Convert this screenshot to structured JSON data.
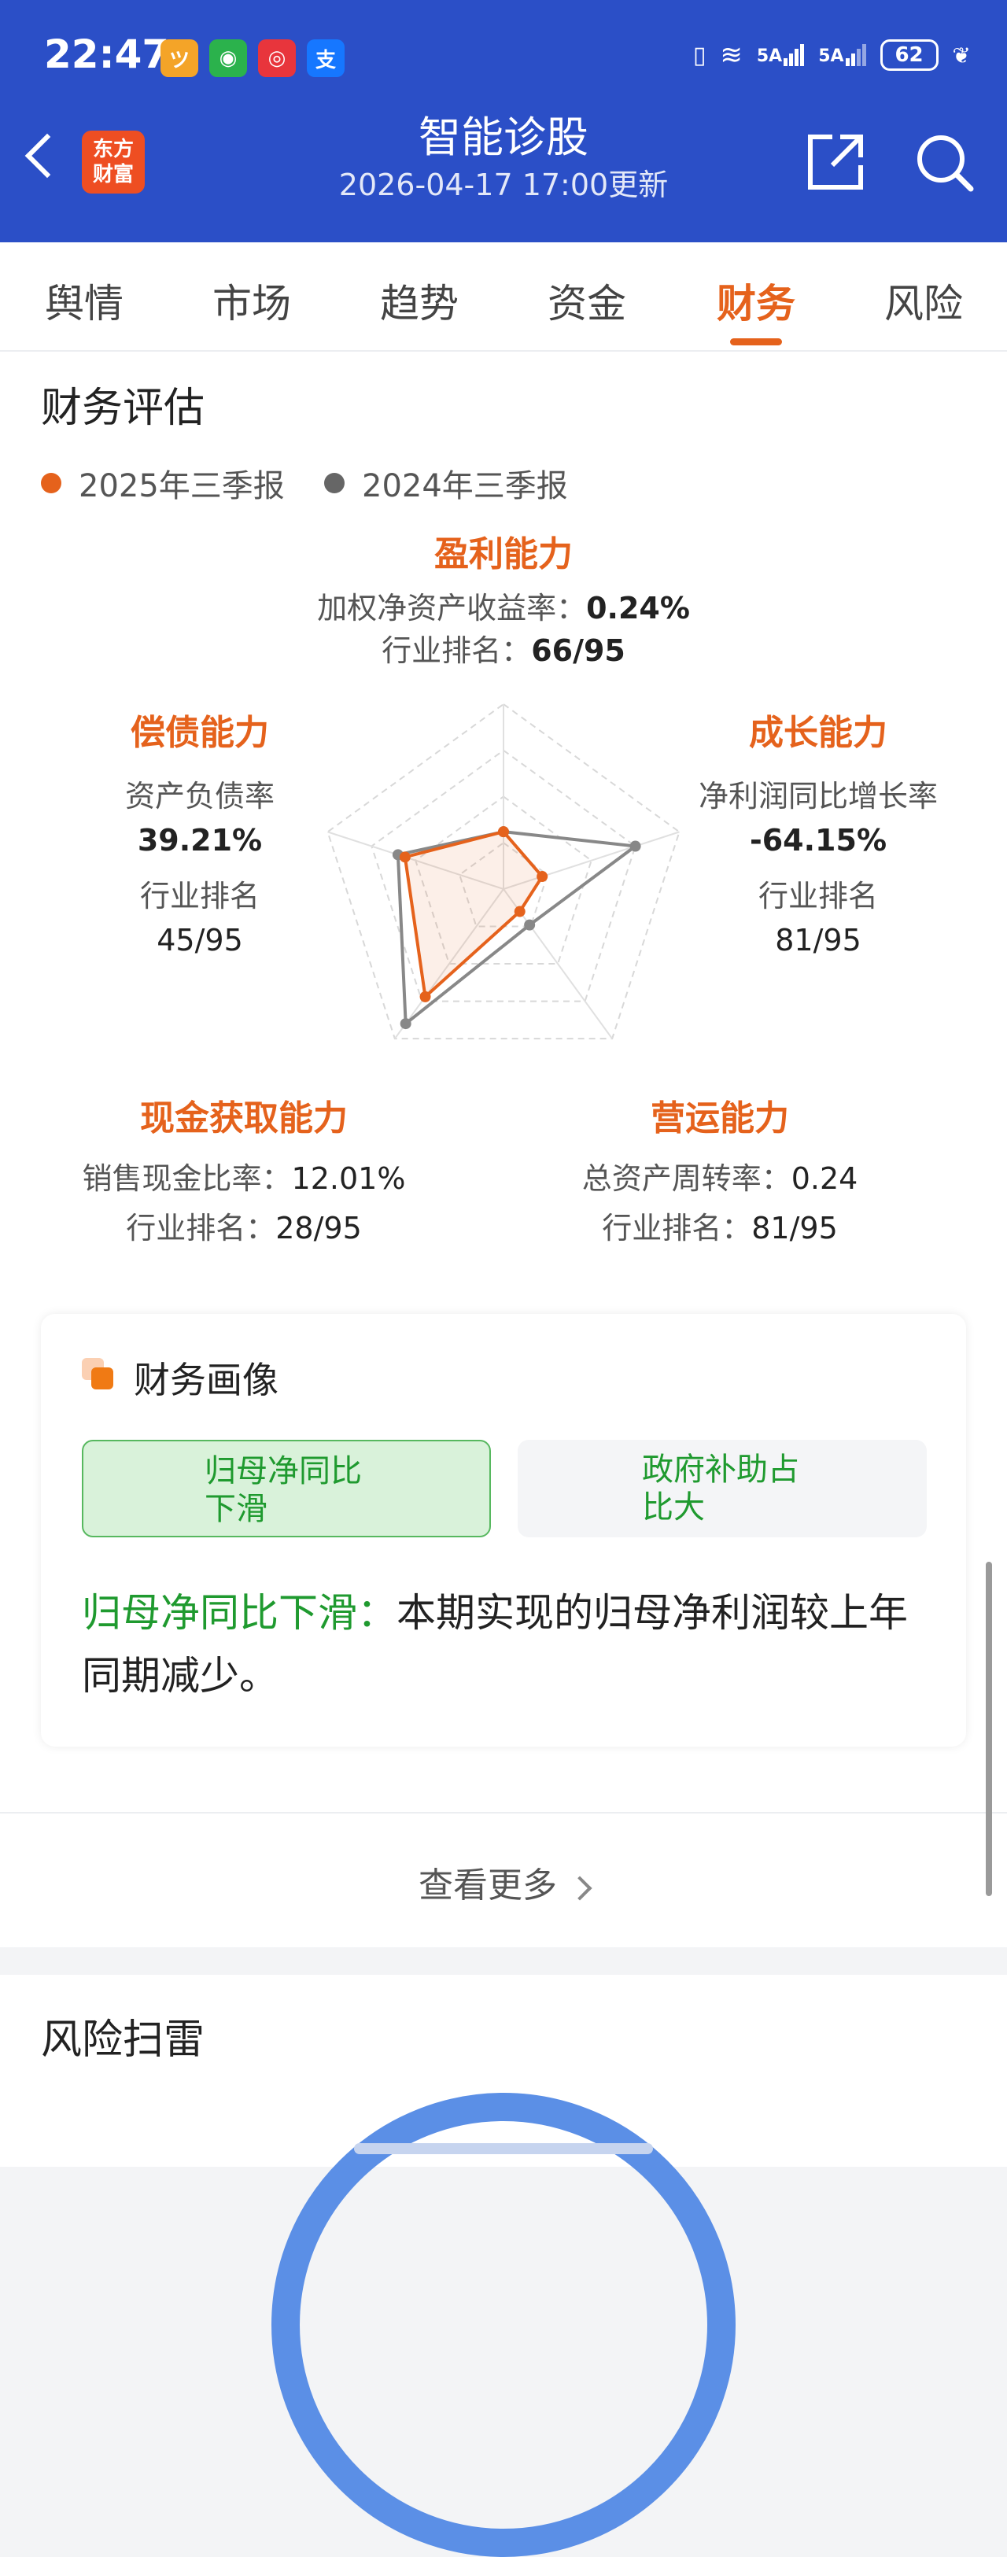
{
  "status_bar": {
    "time": "22:47",
    "net1": "5A",
    "net2": "5A",
    "battery": "62",
    "apps": [
      {
        "name": "app-icon-yellow",
        "color": "#f4a428",
        "glyph": "ツ"
      },
      {
        "name": "app-icon-green",
        "color": "#2bb24c",
        "glyph": "◉"
      },
      {
        "name": "app-icon-red",
        "color": "#e8353c",
        "glyph": "◎"
      },
      {
        "name": "alipay-icon",
        "color": "#1677ff",
        "glyph": "支"
      }
    ]
  },
  "header": {
    "brand_line1": "东方",
    "brand_line2": "财富",
    "title": "智能诊股",
    "subtitle": "2026-04-17 17:00更新",
    "bg_color": "#2b4fc7"
  },
  "tabs": [
    "舆情",
    "市场",
    "趋势",
    "资金",
    "财务",
    "风险"
  ],
  "active_tab_color": "#e5621c",
  "financial_eval": {
    "title": "财务评估",
    "legend": [
      {
        "label": "2025年三季报",
        "color": "#e5621c"
      },
      {
        "label": "2024年三季报",
        "color": "#666666"
      }
    ],
    "profit": {
      "title": "盈利能力",
      "metric_label": "加权净资产收益率：",
      "metric_value": "0.24%",
      "rank_label": "行业排名：",
      "rank_value": "66/95"
    },
    "debt": {
      "title": "偿债能力",
      "metric_label": "资产负债率",
      "metric_value": "39.21%",
      "rank_label": "行业排名",
      "rank_value": "45/95"
    },
    "growth": {
      "title": "成长能力",
      "metric_label": "净利润同比增长率",
      "metric_value": "-64.15%",
      "rank_label": "行业排名",
      "rank_value": "81/95"
    },
    "cash": {
      "title": "现金获取能力",
      "metric_label": "销售现金比率：",
      "metric_value": "12.01%",
      "rank_label": "行业排名：",
      "rank_value": "28/95"
    },
    "operation": {
      "title": "营运能力",
      "metric_label": "总资产周转率：",
      "metric_value": "0.24",
      "rank_label": "行业排名：",
      "rank_value": "81/95"
    }
  },
  "chart_data": {
    "type": "radar",
    "axes": [
      "盈利能力",
      "成长能力",
      "营运能力",
      "现金获取能力",
      "偿债能力"
    ],
    "range": [
      0,
      1
    ],
    "series": [
      {
        "name": "2025年三季报",
        "color": "#e5621c",
        "values": [
          0.31,
          0.22,
          0.15,
          0.72,
          0.56
        ]
      },
      {
        "name": "2024年三季报",
        "color": "#888888",
        "values": [
          0.31,
          0.75,
          0.24,
          0.9,
          0.6
        ]
      }
    ]
  },
  "portrait": {
    "title": "财务画像",
    "chip1_line1": "归母净同比",
    "chip1_line2": "下滑",
    "chip2_line1": "政府补助占",
    "chip2_line2": "比大",
    "desc_title": "归母净同比下滑：",
    "desc_line1": "本期实现的归母净利润较上年",
    "desc_line2": "同期减少。",
    "highlight_color": "#1f9a2f"
  },
  "more_link": "查看更多",
  "risk": {
    "title": "风险扫雷"
  }
}
